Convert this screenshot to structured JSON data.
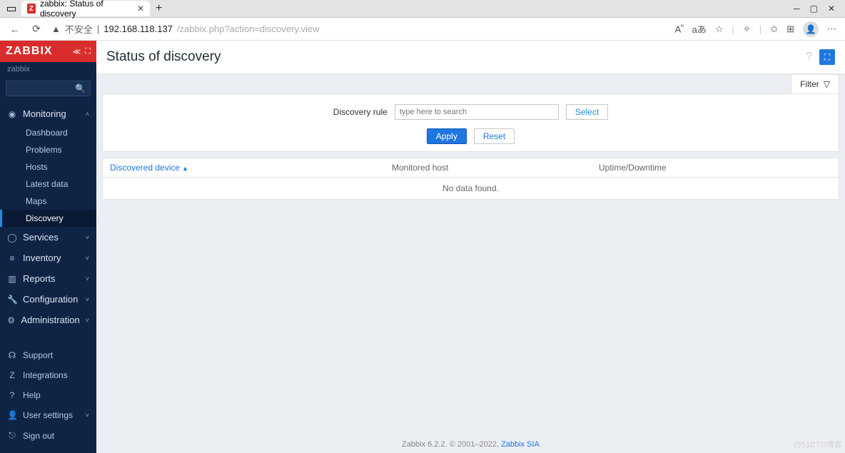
{
  "browser": {
    "tab_title": "zabbix: Status of discovery",
    "url_security": "不安全",
    "url_host": "192.168.118.137",
    "url_path": "/zabbix.php?action=discovery.view",
    "font_icon": "A",
    "read_aloud": "aあ"
  },
  "sidebar": {
    "brand": "ZABBIX",
    "server": "zabbix",
    "sections": {
      "monitoring": {
        "label": "Monitoring",
        "items": [
          "Dashboard",
          "Problems",
          "Hosts",
          "Latest data",
          "Maps",
          "Discovery"
        ]
      },
      "services": {
        "label": "Services"
      },
      "inventory": {
        "label": "Inventory"
      },
      "reports": {
        "label": "Reports"
      },
      "configuration": {
        "label": "Configuration"
      },
      "administration": {
        "label": "Administration"
      }
    },
    "bottom": {
      "support": "Support",
      "integrations": "Integrations",
      "help": "Help",
      "user_settings": "User settings",
      "sign_out": "Sign out"
    }
  },
  "page": {
    "title": "Status of discovery",
    "filter_tab": "Filter",
    "filter": {
      "label": "Discovery rule",
      "placeholder": "type here to search",
      "select": "Select",
      "apply": "Apply",
      "reset": "Reset"
    },
    "table": {
      "col_discovered": "Discovered device",
      "col_monitored": "Monitored host",
      "col_uptime": "Uptime/Downtime",
      "no_data": "No data found."
    },
    "footer_text": "Zabbix 6.2.2. © 2001–2022, ",
    "footer_link": "Zabbix SIA",
    "watermark": "@51CTO博客"
  }
}
